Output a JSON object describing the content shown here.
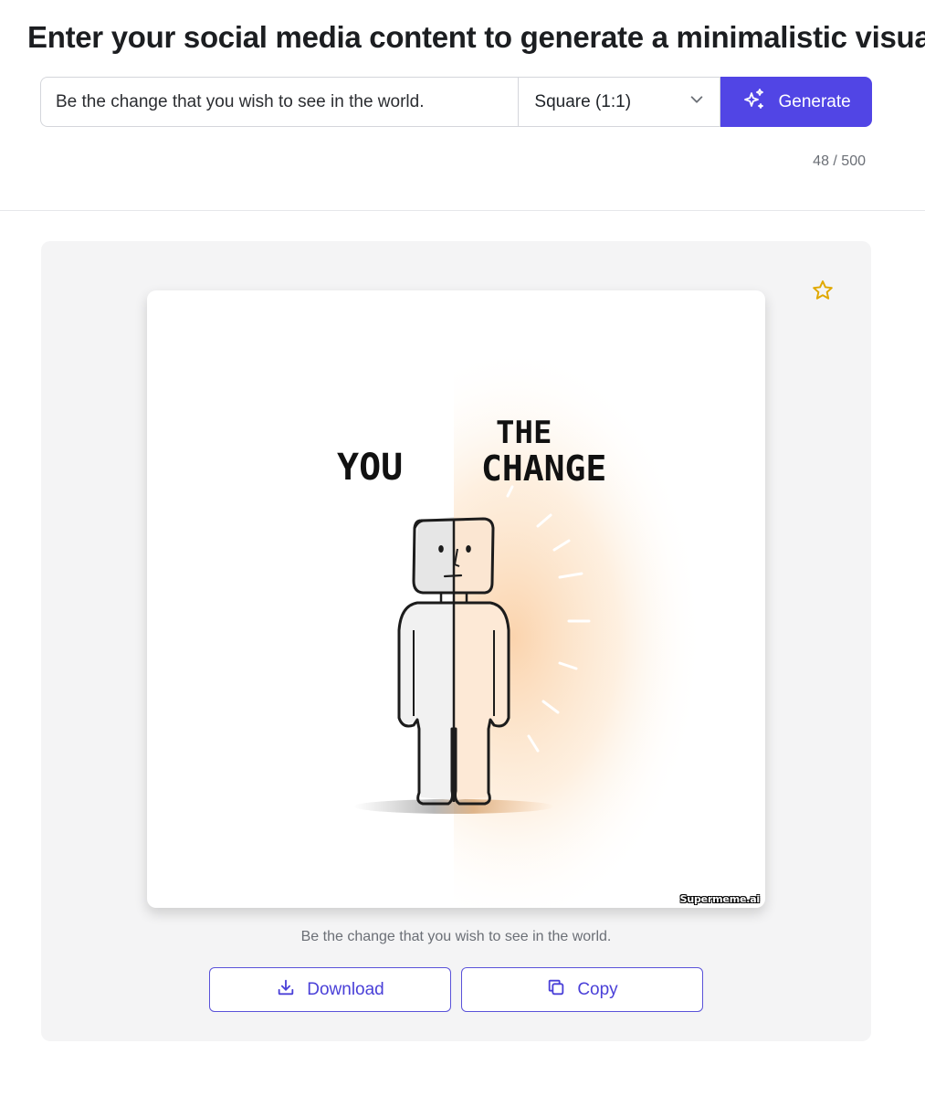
{
  "page": {
    "title": "Enter your social media content to generate a minimalistic visual"
  },
  "form": {
    "content_value": "Be the change that you wish to see in the world.",
    "aspect_ratio": "Square (1:1)",
    "generate_label": "Generate",
    "char_count": "48 / 500"
  },
  "result": {
    "image": {
      "text_left": "YOU",
      "text_right_line1": "THE",
      "text_right_line2": "CHANGE",
      "watermark": "Supermeme.ai"
    },
    "caption": "Be the change that you wish to see in the world.",
    "download_label": "Download",
    "copy_label": "Copy",
    "favorite_icon": "star-outline-icon"
  },
  "colors": {
    "accent": "#5145e5",
    "star": "#e0a800",
    "glow": "#f7b06a"
  }
}
